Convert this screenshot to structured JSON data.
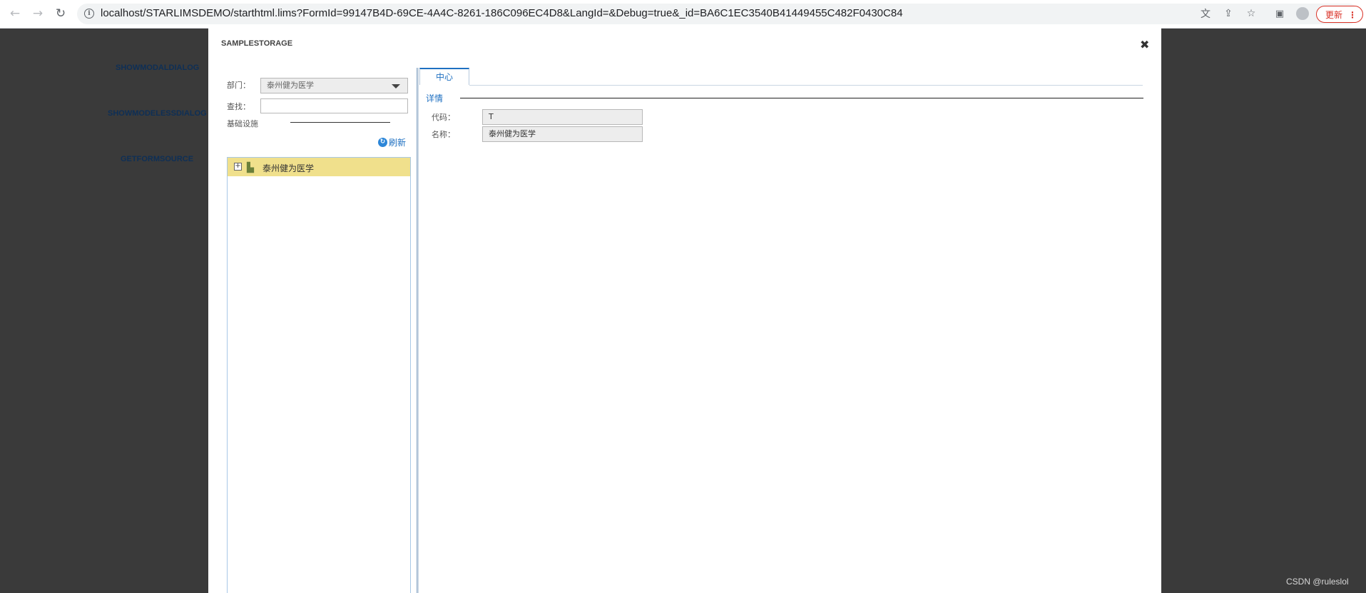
{
  "browser": {
    "url": "localhost/STARLIMSDEMO/starthtml.lims?FormId=99147B4D-69CE-4A4C-8261-186C096EC4D8&LangId=&Debug=true&_id=BA6C1EC3540B41449455C482F0430C84",
    "update_label": "更新",
    "icons": [
      "back-icon",
      "forward-icon",
      "reload-icon",
      "info-icon",
      "translate-icon",
      "share-icon",
      "star-icon",
      "sidepanel-icon",
      "profile-icon",
      "menu-icon"
    ]
  },
  "background": {
    "links": [
      "SHOWMODALDIALOG",
      "SHOWMODELESSDIALOG",
      "GETFORMSOURCE"
    ]
  },
  "dialog": {
    "title": "SAMPLESTORAGE",
    "close_symbol": "✖",
    "left": {
      "dept_label": "部门：",
      "dept_value": "泰州健为医学",
      "search_label": "查找：",
      "search_value": "",
      "infra_label": "基础设施",
      "refresh_label": "刷新",
      "tree": [
        {
          "label": "泰州健为医学",
          "expander": "+",
          "selected": true
        }
      ]
    },
    "right": {
      "tab_label": "中心",
      "section_label": "详情",
      "fields": [
        {
          "label": "代码：",
          "value": "T"
        },
        {
          "label": "名称：",
          "value": "泰州健为医学"
        }
      ]
    }
  },
  "watermark": "CSDN @ruleslol",
  "colors": {
    "accent": "#1f70c1",
    "selected_row": "#f0e08c",
    "overlay": "#3a3a3a",
    "update": "#d93025"
  }
}
